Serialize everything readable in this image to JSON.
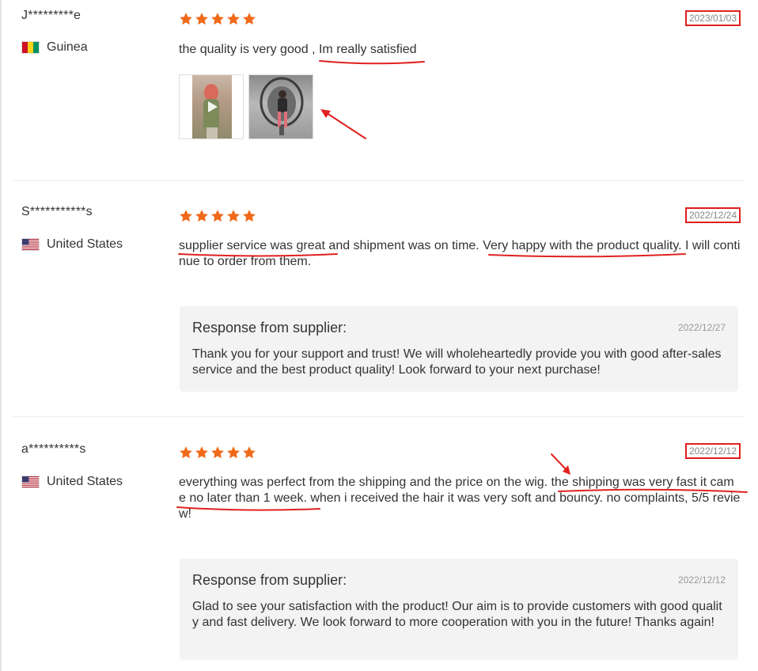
{
  "reviews": [
    {
      "user": "J*********e",
      "country": "Guinea",
      "flag": "guinea-flag",
      "rating": 5,
      "date": "2023/01/03",
      "text": "the quality is very good , Im really satisfied",
      "media": [
        "video-thumbnail",
        "photo-thumbnail"
      ]
    },
    {
      "user": "S***********s",
      "country": "United States",
      "flag": "us-flag",
      "rating": 5,
      "date": "2022/12/24",
      "text": "supplier service was great and shipment was on time. Very happy with the product quality. I will continue to order from them.",
      "response": {
        "title": "Response from supplier:",
        "date": "2022/12/27",
        "text": "Thank you for your support and trust! We will wholeheartedly provide you with good after-sales service and the best product quality! Look forward to your next purchase!"
      }
    },
    {
      "user": "a**********s",
      "country": "United States",
      "flag": "us-flag",
      "rating": 5,
      "date": "2022/12/12",
      "text": "everything was perfect from the shipping and the price on the wig. the shipping was very fast it came no later than 1 week. when i received the hair it was very soft and bouncy. no complaints, 5/5 review!",
      "response": {
        "title": "Response from supplier:",
        "date": "2022/12/12",
        "text": "Glad to see your satisfaction with the product! Our aim is to provide customers with good quality and fast delivery. We look forward to more cooperation with you in the future! Thanks again!"
      }
    }
  ],
  "colors": {
    "star": "#f06a1a",
    "annotation": "#e02020",
    "response_bg": "#f3f3f3"
  }
}
